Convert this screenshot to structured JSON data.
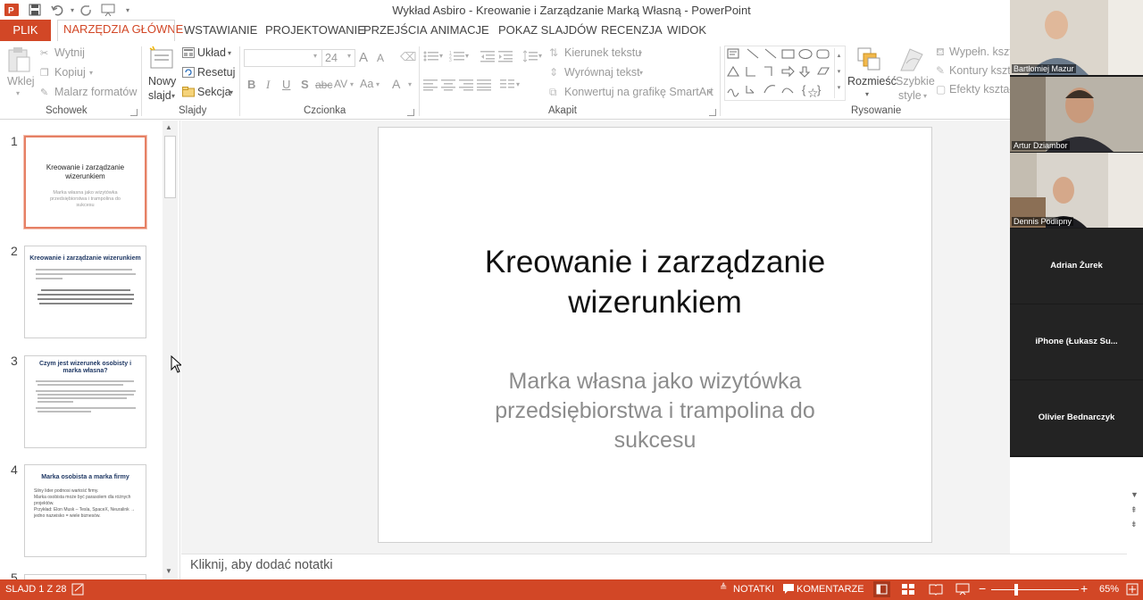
{
  "window": {
    "title": "Wykład Asbiro - Kreowanie i Zarządzanie Marką Własną - PowerPoint"
  },
  "tabs": {
    "file": "PLIK",
    "items": [
      "NARZĘDZIA GŁÓWNE",
      "WSTAWIANIE",
      "PROJEKTOWANIE",
      "PRZEJŚCIA",
      "ANIMACJE",
      "POKAZ SLAJDÓW",
      "RECENZJA",
      "WIDOK"
    ]
  },
  "ribbon": {
    "clipboard": {
      "paste": "Wklej",
      "cut": "Wytnij",
      "copy": "Kopiuj",
      "painter": "Malarz formatów",
      "group": "Schowek"
    },
    "slides": {
      "new_line1": "Nowy",
      "new_line2": "slajd",
      "layout": "Układ",
      "reset": "Resetuj",
      "section": "Sekcja",
      "group": "Slajdy"
    },
    "font": {
      "size": "24",
      "group": "Czcionka",
      "bold": "B",
      "italic": "I",
      "underline": "U",
      "shadow": "S",
      "strike": "abc",
      "spacing": "AV",
      "case": "Aa",
      "color": "A",
      "grow": "A",
      "shrink": "A"
    },
    "paragraph": {
      "direction": "Kierunek tekstu",
      "align": "Wyrównaj tekst",
      "smartart": "Konwertuj na grafikę SmartArt",
      "group": "Akapit"
    },
    "drawing": {
      "arrange": "Rozmieść",
      "quick_line1": "Szybkie",
      "quick_line2": "style",
      "fill": "Wypełn. kszt",
      "outline": "Kontury kszt",
      "effects": "Efekty kształ",
      "group": "Rysowanie"
    }
  },
  "thumbnails": [
    {
      "num": "1",
      "title": "Kreowanie i zarządzanie wizerunkiem",
      "subtitle": "Marka własna jako wizytówka przedsiębiorstwa i trampolina do sukcesu"
    },
    {
      "num": "2",
      "title": "Kreowanie i zarządzanie wizerunkiem"
    },
    {
      "num": "3",
      "title": "Czym jest wizerunek osobisty i marka własna?"
    },
    {
      "num": "4",
      "title": "Marka osobista a marka firmy",
      "bullets": [
        "Silny lider podnosi wartość firmy.",
        "Marka osobista może być parasolem dla różnych projektów.",
        "Przykład: Elon Musk – Tesla, SpaceX, Neuralink → jedno nazwisko = wiele biznesów."
      ]
    },
    {
      "num": "5"
    }
  ],
  "slide": {
    "title_line1": "Kreowanie i zarządzanie",
    "title_line2": "wizerunkiem",
    "subtitle_line1": "Marka własna jako wizytówka",
    "subtitle_line2": "przedsiębiorstwa i trampolina do",
    "subtitle_line3": "sukcesu"
  },
  "notes": {
    "placeholder": "Kliknij, aby dodać notatki"
  },
  "status": {
    "slide": "SLAJD 1 Z 28",
    "notes": "NOTATKI",
    "comments": "KOMENTARZE",
    "zoom": "65%"
  },
  "video": {
    "participants": [
      "Bartłomiej Mazur",
      "Artur Dziambor",
      "Dennis Podlipny",
      "Adrian Żurek",
      "iPhone (Łukasz Su...",
      "Olivier Bednarczyk"
    ]
  },
  "colors": {
    "accent": "#d24726",
    "tab_active": "#d24726",
    "thumb_title": "#1f3864",
    "subtitle": "#8c8c8c"
  }
}
